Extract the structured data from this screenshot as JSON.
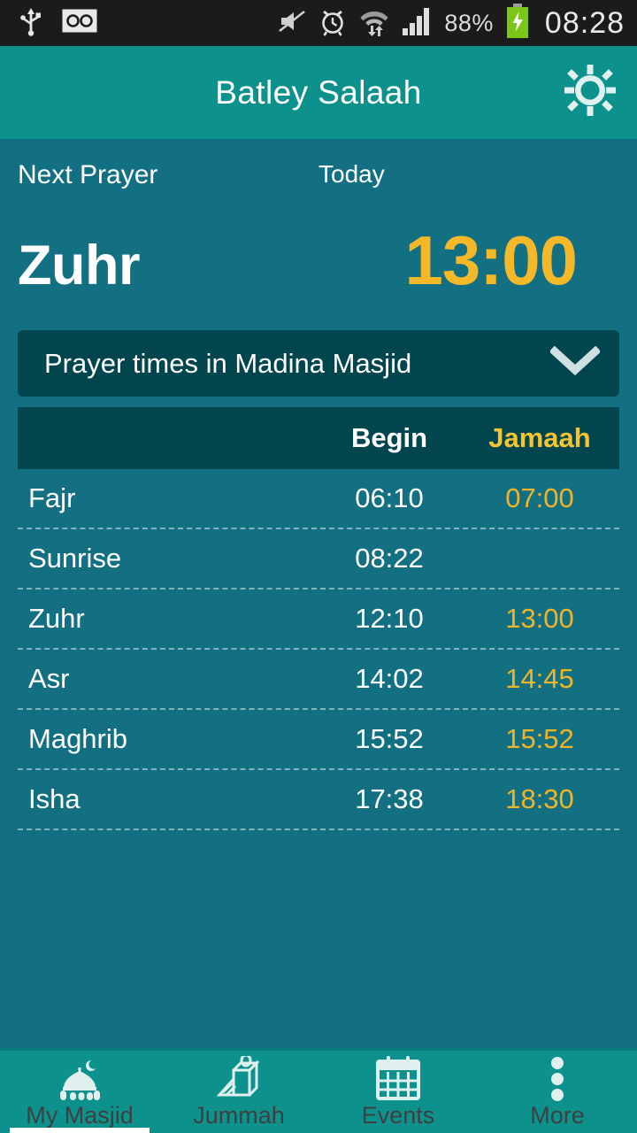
{
  "statusbar": {
    "icons_left": [
      "usb-icon",
      "voicemail-icon"
    ],
    "icons_right": [
      "mute-icon",
      "alarm-icon",
      "wifi-icon",
      "signal-icon"
    ],
    "battery_percent": "88%",
    "battery_state": "charging",
    "clock": "08:28"
  },
  "appbar": {
    "title": "Batley Salaah",
    "settings_icon": "gear-icon"
  },
  "next_prayer": {
    "label": "Next Prayer",
    "day_label": "Today",
    "name": "Zuhr",
    "time": "13:00"
  },
  "selector": {
    "label": "Prayer times in Madina Masjid",
    "chevron": "chevron-down-icon"
  },
  "table": {
    "headers": {
      "name": "",
      "begin": "Begin",
      "jamaah": "Jamaah"
    },
    "rows": [
      {
        "name": "Fajr",
        "begin": "06:10",
        "jamaah": "07:00"
      },
      {
        "name": "Sunrise",
        "begin": "08:22",
        "jamaah": ""
      },
      {
        "name": "Zuhr",
        "begin": "12:10",
        "jamaah": "13:00"
      },
      {
        "name": "Asr",
        "begin": "14:02",
        "jamaah": "14:45"
      },
      {
        "name": "Maghrib",
        "begin": "15:52",
        "jamaah": "15:52"
      },
      {
        "name": "Isha",
        "begin": "17:38",
        "jamaah": "18:30"
      }
    ]
  },
  "bottomnav": {
    "tabs": [
      {
        "label": "My Masjid",
        "icon": "mosque-icon",
        "active": true
      },
      {
        "label": "Jummah",
        "icon": "minbar-icon",
        "active": false
      },
      {
        "label": "Events",
        "icon": "calendar-icon",
        "active": false
      },
      {
        "label": "More",
        "icon": "more-dots-icon",
        "active": false
      }
    ]
  },
  "colors": {
    "background": "#137082",
    "appbar": "#0d918c",
    "panel_dark": "#01454f",
    "accent_yellow": "#f5b828",
    "text_white": "#ffffff",
    "statusbar": "#1b1b1b"
  }
}
